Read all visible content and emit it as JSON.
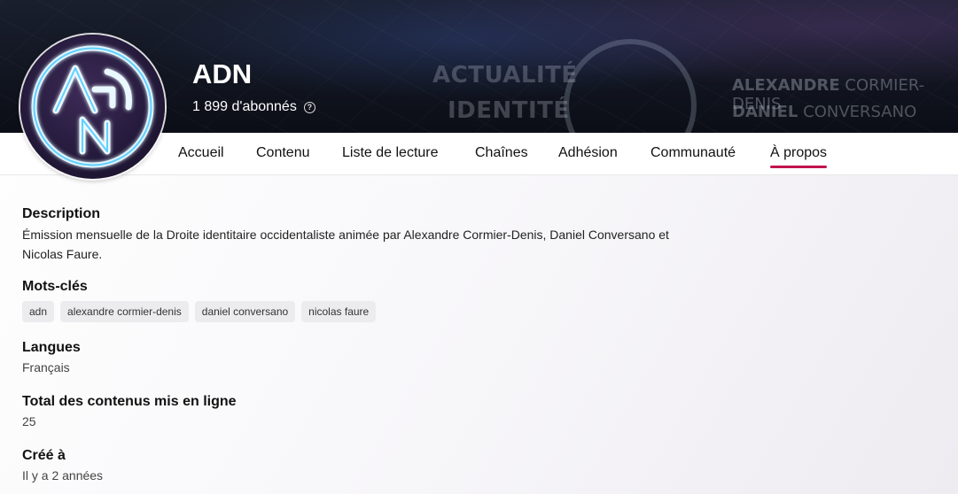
{
  "channel": {
    "name": "ADN",
    "subscribers": "1 899 d'abonnés",
    "avatar_letters": "ADN"
  },
  "banner": {
    "words": [
      "ACTUALITÉ",
      "IDENTITÉ"
    ],
    "names": [
      {
        "first": "ALEXANDRE",
        "last": "CORMIER-DENIS"
      },
      {
        "first": "DANIEL",
        "last": "CONVERSANO"
      }
    ]
  },
  "nav": {
    "items": [
      {
        "label": "Accueil"
      },
      {
        "label": "Contenu"
      },
      {
        "label": "Liste de lecture"
      },
      {
        "label": "Chaînes"
      },
      {
        "label": "Adhésion"
      },
      {
        "label": "Communauté"
      },
      {
        "label": "À propos"
      }
    ],
    "active": "À propos",
    "accent_color": "#c1134e"
  },
  "about": {
    "description": {
      "title": "Description",
      "line1": "Émission mensuelle de la Droite identitaire occidentaliste animée par Alexandre Cormier-Denis, Daniel Conversano et",
      "line2": "Nicolas Faure."
    },
    "keywords": {
      "title": "Mots-clés",
      "tags": [
        "adn",
        "alexandre cormier-denis",
        "daniel conversano",
        "nicolas faure"
      ]
    },
    "languages": {
      "title": "Langues",
      "value": "Français"
    },
    "total_uploads": {
      "title": "Total des contenus mis en ligne",
      "value": "25"
    },
    "created": {
      "title": "Créé à",
      "value": "Il y a 2 années"
    }
  },
  "icons": {
    "help": "help-circle-icon"
  }
}
